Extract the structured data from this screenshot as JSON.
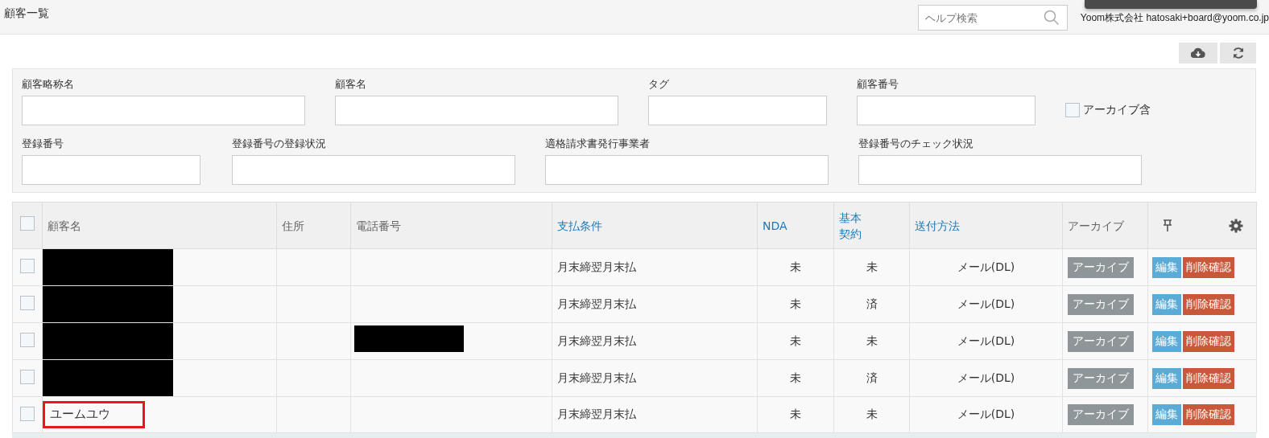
{
  "header": {
    "title": "顧客一覧",
    "help_search": {
      "placeholder": "ヘルプ検索"
    },
    "user": "Yoom株式会社 hatosaki+board@yoom.co.jp"
  },
  "filters": {
    "fields": [
      {
        "label": "顧客略称名"
      },
      {
        "label": "顧客名"
      },
      {
        "label": "タグ"
      },
      {
        "label": "顧客番号"
      },
      {
        "label": "登録番号"
      },
      {
        "label": "登録番号の登録状況"
      },
      {
        "label": "適格請求書発行事業者"
      },
      {
        "label": "登録番号のチェック状況"
      }
    ],
    "archive_checkbox": {
      "label": "アーカイブ含",
      "checked": false
    }
  },
  "table": {
    "select_all_checked": false,
    "columns": [
      {
        "label": "顧客名",
        "sortable": false
      },
      {
        "label": "住所",
        "sortable": false
      },
      {
        "label": "電話番号",
        "sortable": false
      },
      {
        "label": "支払条件",
        "sortable": true
      },
      {
        "label": "NDA",
        "sortable": true
      },
      {
        "label": "基本契約",
        "sortable": true
      },
      {
        "label": "送付方法",
        "sortable": true
      },
      {
        "label": "アーカイブ",
        "sortable": false
      }
    ],
    "rows": [
      {
        "checked": false,
        "name_redacted": true,
        "phone_redacted": false,
        "highlighted": false,
        "payment": "月末締翌月末払",
        "nda": "未",
        "contract": "未",
        "delivery": "メール(DL)",
        "archive_button": "アーカイブ",
        "edit_button": "編集",
        "delete_button": "削除確認"
      },
      {
        "checked": false,
        "name_redacted": true,
        "phone_redacted": false,
        "highlighted": false,
        "payment": "月末締翌月末払",
        "nda": "未",
        "contract": "済",
        "delivery": "メール(DL)",
        "archive_button": "アーカイブ",
        "edit_button": "編集",
        "delete_button": "削除確認"
      },
      {
        "checked": false,
        "name_redacted": true,
        "phone_redacted": true,
        "highlighted": false,
        "payment": "月末締翌月末払",
        "nda": "未",
        "contract": "未",
        "delivery": "メール(DL)",
        "archive_button": "アーカイブ",
        "edit_button": "編集",
        "delete_button": "削除確認"
      },
      {
        "checked": false,
        "name_redacted": true,
        "phone_redacted": false,
        "highlighted": false,
        "payment": "月末締翌月末払",
        "nda": "未",
        "contract": "済",
        "delivery": "メール(DL)",
        "archive_button": "アーカイブ",
        "edit_button": "編集",
        "delete_button": "削除確認"
      },
      {
        "checked": false,
        "name": "ユームユウ",
        "name_redacted": false,
        "phone_redacted": false,
        "highlighted": true,
        "payment": "月末締翌月末払",
        "nda": "未",
        "contract": "未",
        "delivery": "メール(DL)",
        "archive_button": "アーカイブ",
        "edit_button": "編集",
        "delete_button": "削除確認"
      }
    ]
  }
}
